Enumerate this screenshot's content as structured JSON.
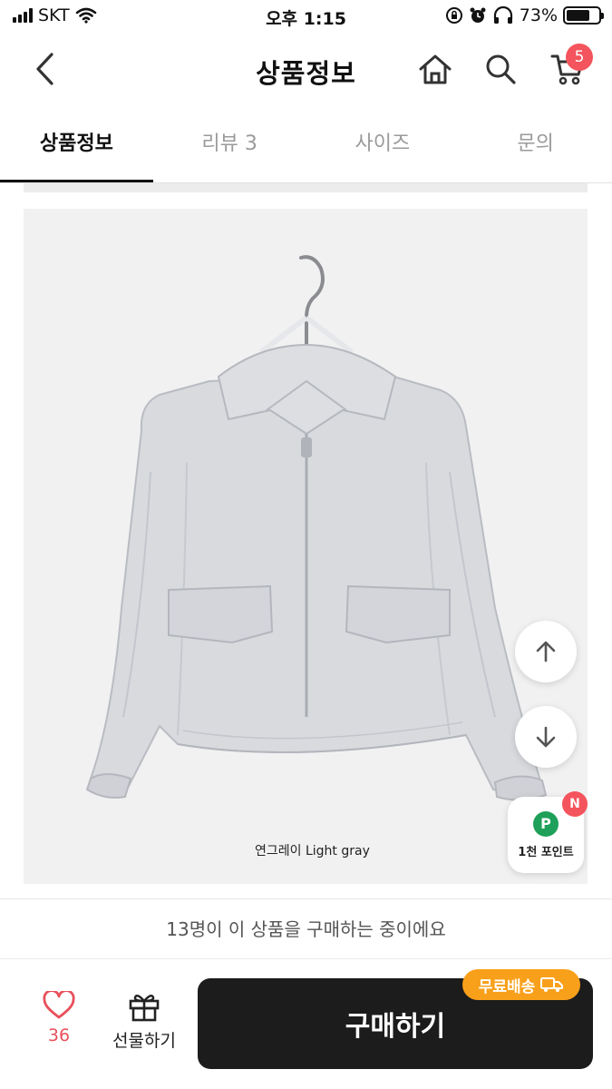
{
  "status_bar": {
    "carrier": "SKT",
    "time": "오후 1:15",
    "battery": "73%",
    "battery_level": 0.73
  },
  "header": {
    "title": "상품정보",
    "cart_count": "5"
  },
  "tabs": [
    {
      "label": "상품정보",
      "active": true
    },
    {
      "label": "리뷰 3",
      "active": false
    },
    {
      "label": "사이즈",
      "active": false
    },
    {
      "label": "문의",
      "active": false
    }
  ],
  "product": {
    "caption": "연그레이  Light gray"
  },
  "points": {
    "icon_letter": "P",
    "label": "1천 포인트",
    "badge": "N"
  },
  "notice": "13명이 이 상품을 구매하는 중이에요",
  "bottom_bar": {
    "like_count": "36",
    "gift_label": "선물하기",
    "buy_label": "구매하기",
    "shipping_badge": "무료배송"
  },
  "colors": {
    "accent_red": "#f4545d",
    "buy_button": "#1c1c1c",
    "shipping_badge": "#f9a01b",
    "point_green": "#1fa05a",
    "jacket": "#d8dade"
  }
}
